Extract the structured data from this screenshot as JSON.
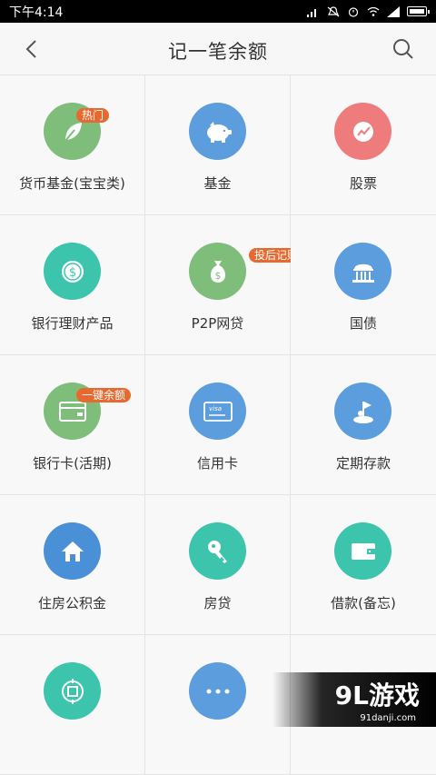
{
  "status_bar": {
    "time": "下午4:14"
  },
  "header": {
    "title": "记一笔余额"
  },
  "items": [
    {
      "label": "货币基金(宝宝类)",
      "icon": "leaf-icon",
      "color": "#7ebd7a",
      "badge": "热门"
    },
    {
      "label": "基金",
      "icon": "piggy-bank-icon",
      "color": "#5b9ddd",
      "badge": ""
    },
    {
      "label": "股票",
      "icon": "stock-trend-icon",
      "color": "#ef7c7c",
      "badge": ""
    },
    {
      "label": "银行理财产品",
      "icon": "coin-icon",
      "color": "#3cc4ad",
      "badge": ""
    },
    {
      "label": "P2P网贷",
      "icon": "money-bag-icon",
      "color": "#7ebd7a",
      "badge": "投后记账"
    },
    {
      "label": "国债",
      "icon": "government-building-icon",
      "color": "#5b9ddd",
      "badge": ""
    },
    {
      "label": "银行卡(活期)",
      "icon": "wallet-card-icon",
      "color": "#7ebd7a",
      "badge": "一键余额"
    },
    {
      "label": "信用卡",
      "icon": "credit-card-icon",
      "color": "#5b9ddd",
      "badge": ""
    },
    {
      "label": "定期存款",
      "icon": "flag-icon",
      "color": "#5b9ddd",
      "badge": ""
    },
    {
      "label": "住房公积金",
      "icon": "home-icon",
      "color": "#4a90d6",
      "badge": ""
    },
    {
      "label": "房贷",
      "icon": "key-icon",
      "color": "#3cc4ad",
      "badge": ""
    },
    {
      "label": "借款(备忘)",
      "icon": "wallet-icon",
      "color": "#3cc4ad",
      "badge": ""
    },
    {
      "label": "",
      "icon": "scan-target-icon",
      "color": "#3cc4ad",
      "badge": ""
    },
    {
      "label": "",
      "icon": "more-icon",
      "color": "#5b9ddd",
      "badge": ""
    }
  ],
  "watermark": {
    "text": "9L游戏",
    "sub": "91danji.com"
  }
}
